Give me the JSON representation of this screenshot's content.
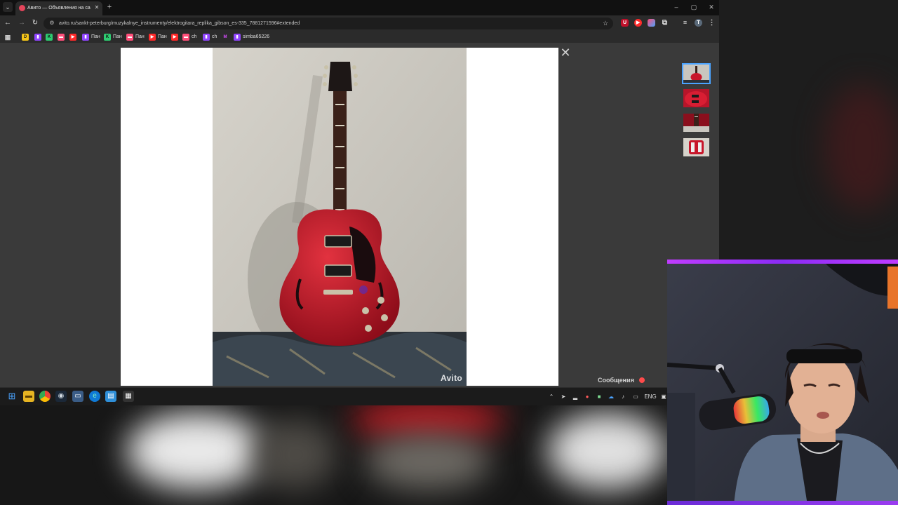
{
  "browser": {
    "tab": {
      "title": "Авито — Объявления на сайт",
      "close": "✕"
    },
    "new_tab": "+",
    "window_controls": {
      "minimize": "–",
      "maximize": "▢",
      "close": "✕"
    },
    "toolbar": {
      "back": "←",
      "forward": "→",
      "reload": "↻",
      "url": "avito.ru/sankt-peterburg/muzykalnye_instrumenty/elektrogitara_replika_gibson_es-335_7881271596#extended",
      "star": "☆"
    },
    "bookmarks": [
      {
        "icon_color": "#f5c518",
        "icon": "D",
        "label": ""
      },
      {
        "icon_color": "#9146ff",
        "icon": "▮",
        "label": ""
      },
      {
        "icon_color": "#2ecc71",
        "icon": "K",
        "label": ""
      },
      {
        "icon_color": "#ff4f7a",
        "icon": "▬",
        "label": ""
      },
      {
        "icon_color": "#ff2a2a",
        "icon": "▶",
        "label": ""
      },
      {
        "icon_color": "#9146ff",
        "icon": "▮",
        "label": "Пан"
      },
      {
        "icon_color": "#2ecc71",
        "icon": "K",
        "label": "Пан"
      },
      {
        "icon_color": "#ff4f7a",
        "icon": "▬",
        "label": "Пан"
      },
      {
        "icon_color": "#ff2a2a",
        "icon": "▶",
        "label": "Пан"
      },
      {
        "icon_color": "#ff2a2a",
        "icon": "▶",
        "label": ""
      },
      {
        "icon_color": "#ff4f7a",
        "icon": "▬",
        "label": "ch"
      },
      {
        "icon_color": "#9146ff",
        "icon": "▮",
        "label": "ch"
      },
      {
        "icon_color": "#d84cff",
        "icon": "M",
        "label": ""
      },
      {
        "icon_color": "#9146ff",
        "icon": "▮",
        "label": "simba65226"
      }
    ]
  },
  "gallery": {
    "watermark": "Avito",
    "close": "✕",
    "thumbnail_count": 4
  },
  "page": {
    "messages_label": "Сообщения",
    "messages_badge": ""
  },
  "taskbar": {
    "language": "ENG"
  },
  "colors": {
    "accent_thumb_border": "#4aa3ff",
    "guitar_red": "#c8162a",
    "webcam_frame": "#b03cff"
  }
}
